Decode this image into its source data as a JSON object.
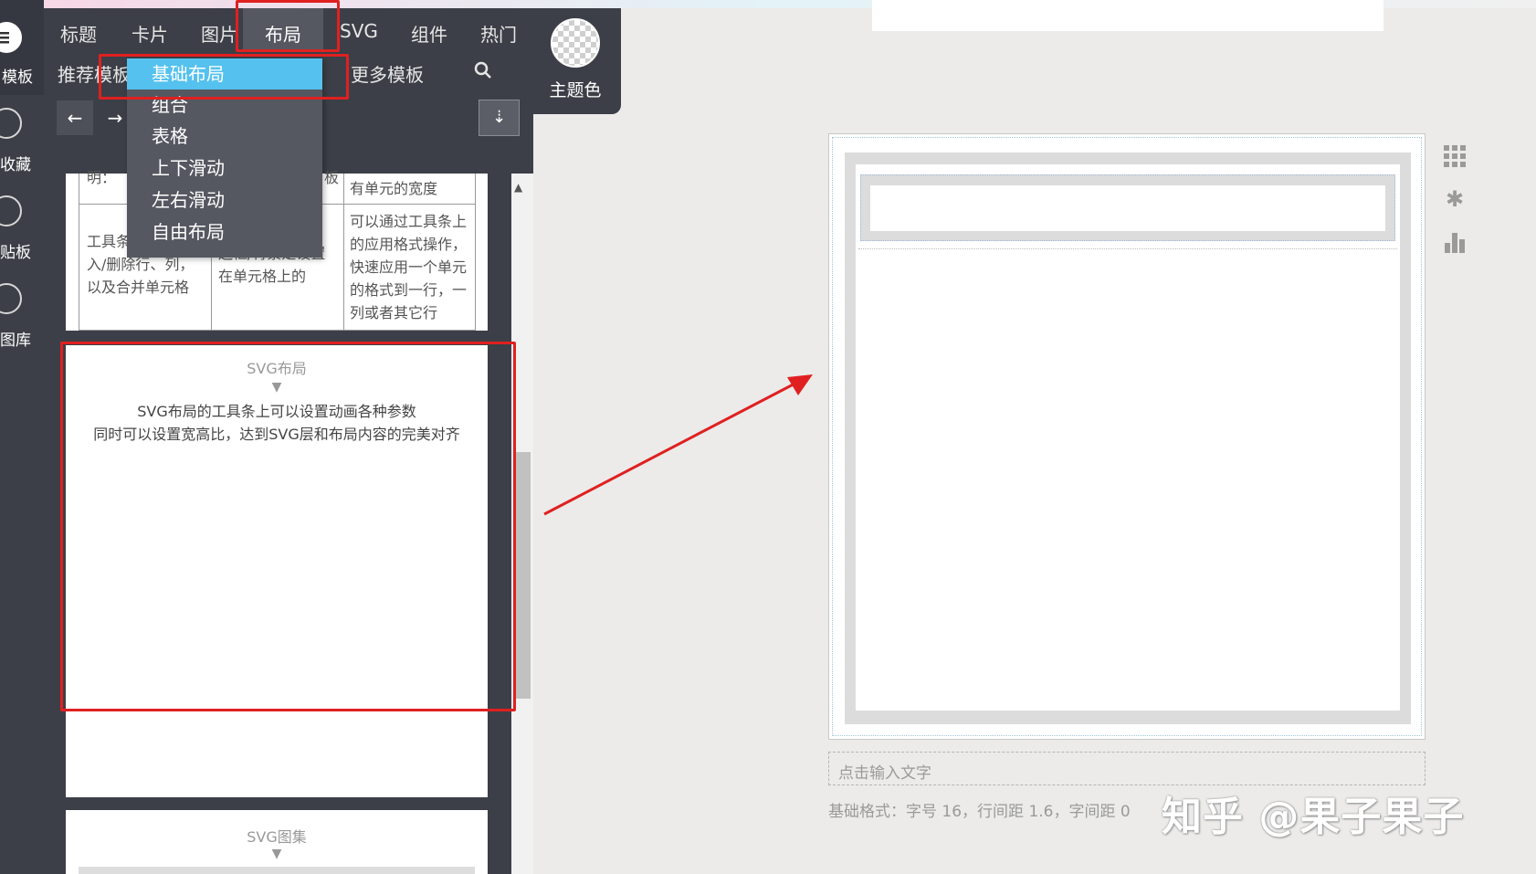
{
  "tabs": [
    {
      "label": "标题"
    },
    {
      "label": "卡片"
    },
    {
      "label": "图片"
    },
    {
      "label": "布局"
    },
    {
      "label": "SVG"
    },
    {
      "label": "组件"
    },
    {
      "label": "热门"
    }
  ],
  "subnav": {
    "recommended": "推荐模板",
    "more": "更多模板"
  },
  "theme": {
    "label": "主题色"
  },
  "rail": {
    "templates": "模板",
    "favorites": "收藏",
    "clipboard": "贴板",
    "gallery": "图库"
  },
  "dropdown": {
    "items": [
      "基础布局",
      "组合",
      "表格",
      "上下滑动",
      "左右滑动",
      "自由布局"
    ]
  },
  "table": {
    "top_left": "明：",
    "top_mid": "板",
    "top_right": "有单元的宽度",
    "col1": [
      "工具条",
      "入/删除行、列，",
      "以及合并单元格"
    ],
    "col2": [
      "边框/背景是设置",
      "在单元格上的"
    ],
    "col3": [
      "可以通过工具条上",
      "的应用格式操作，",
      "快速应用一个单元",
      "的格式到一行，一",
      "列或者其它行"
    ]
  },
  "svg_layout_card": {
    "title": "SVG布局",
    "marker": "▼",
    "line1": "SVG布局的工具条上可以设置动画各种参数",
    "line2": "同时可以设置宽高比，达到SVG层和布局内容的完美对齐"
  },
  "svg_atlas_card": {
    "title": "SVG图集",
    "marker": "▼"
  },
  "editor": {
    "input_placeholder": "点击输入文字",
    "format_note": "基础格式：字号 16，行间距 1.6，字间距 0"
  },
  "watermark": "知乎 @果子果子",
  "colors": {
    "panel": "#3c3f47",
    "highlight": "#55c1ee",
    "annotation_red": "#e02020",
    "canvas_bg": "#ecebea"
  }
}
